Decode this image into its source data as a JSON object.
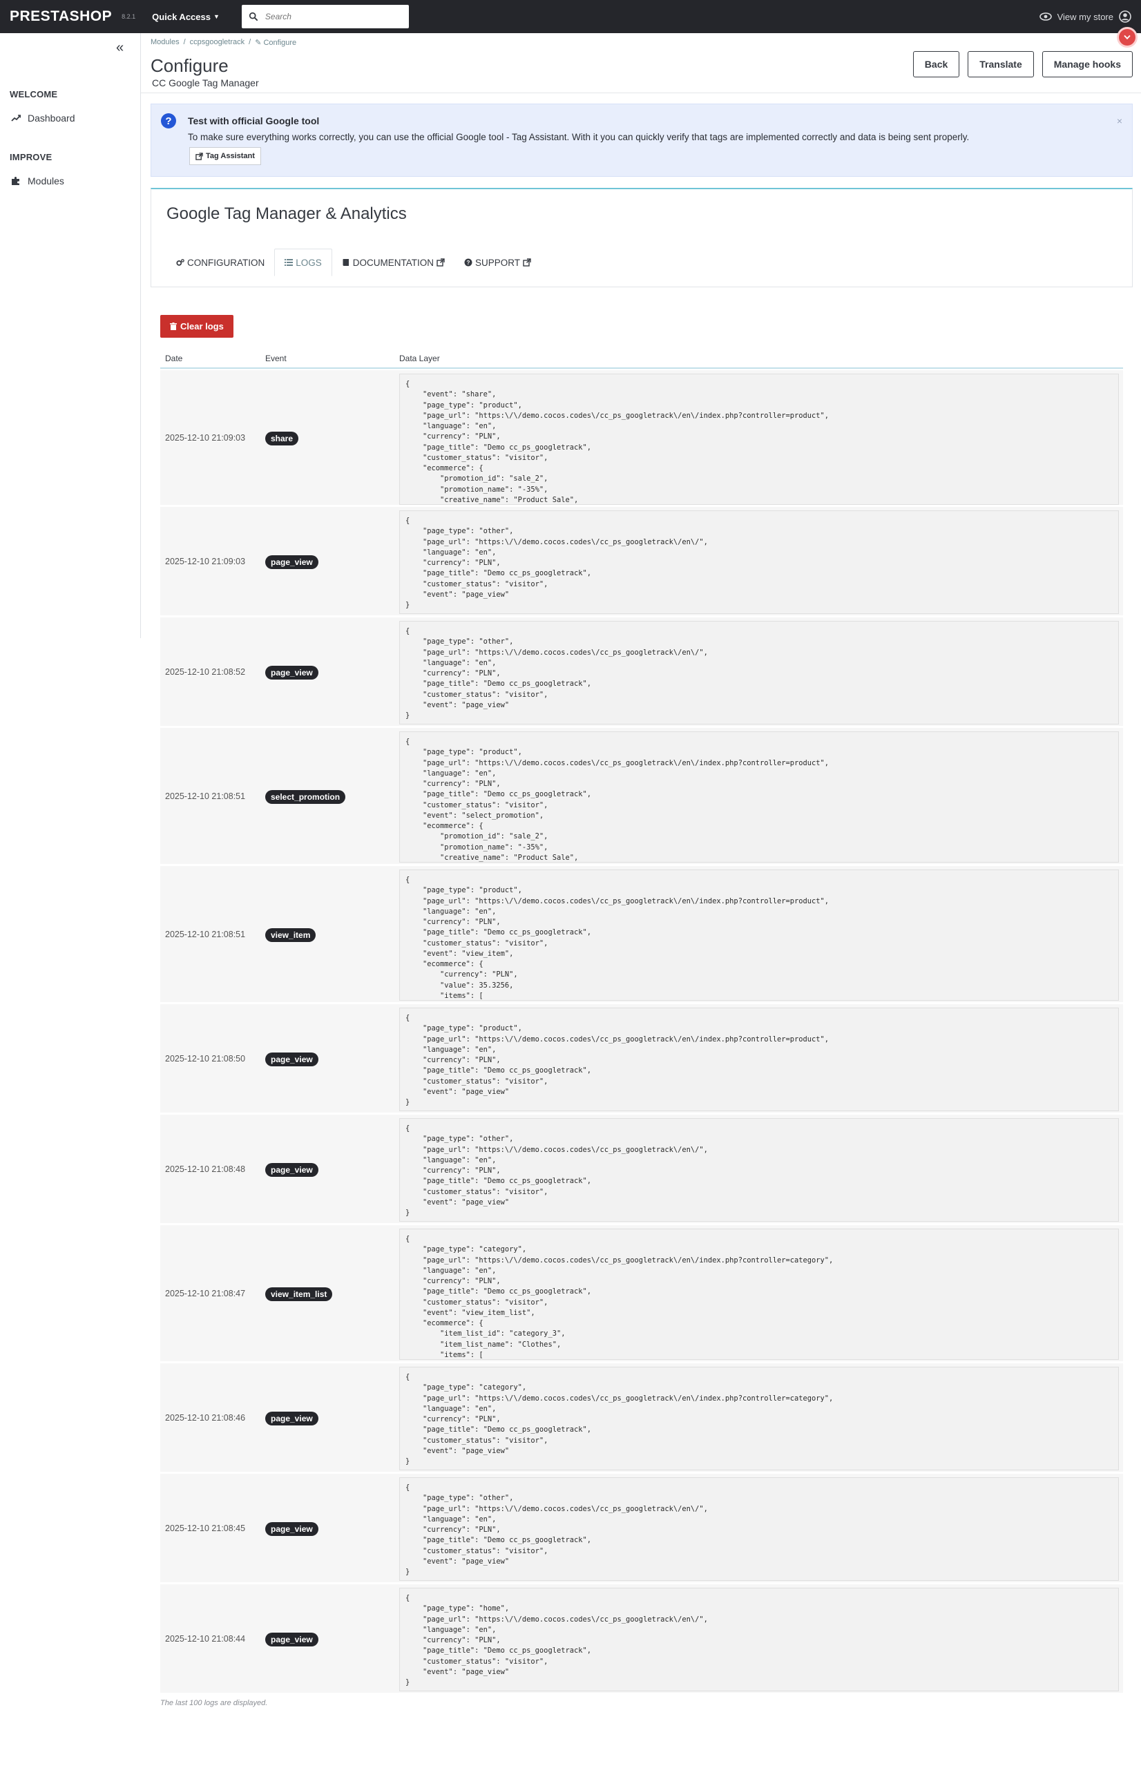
{
  "topbar": {
    "logo": "PRESTASHOP",
    "version": "8.2.1",
    "quick_access": "Quick Access",
    "search_placeholder": "Search",
    "view_store": "View my store"
  },
  "sidebar": {
    "sections": [
      {
        "title": "WELCOME",
        "items": [
          {
            "label": "Dashboard",
            "icon": "trending-up-icon"
          }
        ]
      },
      {
        "title": "IMPROVE",
        "items": [
          {
            "label": "Modules",
            "icon": "puzzle-icon"
          }
        ]
      }
    ]
  },
  "header": {
    "breadcrumb": [
      "Modules",
      "ccpsgoogletrack",
      "Configure"
    ],
    "title": "Configure",
    "subtitle": "CC Google Tag Manager",
    "buttons": {
      "back": "Back",
      "translate": "Translate",
      "manage_hooks": "Manage hooks"
    }
  },
  "alert": {
    "title": "Test with official Google tool",
    "text": "To make sure everything works correctly, you can use the official Google tool - Tag Assistant. With it you can quickly verify that tags are implemented correctly and data is being sent properly.",
    "button": "Tag Assistant",
    "close": "×"
  },
  "module": {
    "title": "Google Tag Manager & Analytics",
    "tabs": [
      {
        "label": "CONFIGURATION",
        "icon": "cogs-icon",
        "active": false
      },
      {
        "label": "LOGS",
        "icon": "list-icon",
        "active": true
      },
      {
        "label": "DOCUMENTATION",
        "icon": "book-icon",
        "active": false
      },
      {
        "label": "SUPPORT",
        "icon": "question-circle-icon",
        "active": false
      }
    ]
  },
  "logs": {
    "clear_button": "Clear logs",
    "columns": {
      "date": "Date",
      "event": "Event",
      "data_layer": "Data Layer"
    },
    "rows": [
      {
        "date": "2025-12-10 21:09:03",
        "event": "share",
        "data": "{\n    \"event\": \"share\",\n    \"page_type\": \"product\",\n    \"page_url\": \"https:\\/\\/demo.cocos.codes\\/cc_ps_googletrack\\/en\\/index.php?controller=product\",\n    \"language\": \"en\",\n    \"currency\": \"PLN\",\n    \"page_title\": \"Demo cc_ps_googletrack\",\n    \"customer_status\": \"visitor\",\n    \"ecommerce\": {\n        \"promotion_id\": \"sale_2\",\n        \"promotion_name\": \"-35%\",\n        \"creative_name\": \"Product Sale\","
      },
      {
        "date": "2025-12-10 21:09:03",
        "event": "page_view",
        "data": "{\n    \"page_type\": \"other\",\n    \"page_url\": \"https:\\/\\/demo.cocos.codes\\/cc_ps_googletrack\\/en\\/\",\n    \"language\": \"en\",\n    \"currency\": \"PLN\",\n    \"page_title\": \"Demo cc_ps_googletrack\",\n    \"customer_status\": \"visitor\",\n    \"event\": \"page_view\"\n}"
      },
      {
        "date": "2025-12-10 21:08:52",
        "event": "page_view",
        "data": "{\n    \"page_type\": \"other\",\n    \"page_url\": \"https:\\/\\/demo.cocos.codes\\/cc_ps_googletrack\\/en\\/\",\n    \"language\": \"en\",\n    \"currency\": \"PLN\",\n    \"page_title\": \"Demo cc_ps_googletrack\",\n    \"customer_status\": \"visitor\",\n    \"event\": \"page_view\"\n}"
      },
      {
        "date": "2025-12-10 21:08:51",
        "event": "select_promotion",
        "data": "{\n    \"page_type\": \"product\",\n    \"page_url\": \"https:\\/\\/demo.cocos.codes\\/cc_ps_googletrack\\/en\\/index.php?controller=product\",\n    \"language\": \"en\",\n    \"currency\": \"PLN\",\n    \"page_title\": \"Demo cc_ps_googletrack\",\n    \"customer_status\": \"visitor\",\n    \"event\": \"select_promotion\",\n    \"ecommerce\": {\n        \"promotion_id\": \"sale_2\",\n        \"promotion_name\": \"-35%\",\n        \"creative_name\": \"Product Sale\","
      },
      {
        "date": "2025-12-10 21:08:51",
        "event": "view_item",
        "data": "{\n    \"page_type\": \"product\",\n    \"page_url\": \"https:\\/\\/demo.cocos.codes\\/cc_ps_googletrack\\/en\\/index.php?controller=product\",\n    \"language\": \"en\",\n    \"currency\": \"PLN\",\n    \"page_title\": \"Demo cc_ps_googletrack\",\n    \"customer_status\": \"visitor\",\n    \"event\": \"view_item\",\n    \"ecommerce\": {\n        \"currency\": \"PLN\",\n        \"value\": 35.3256,\n        \"items\": ["
      },
      {
        "date": "2025-12-10 21:08:50",
        "event": "page_view",
        "data": "{\n    \"page_type\": \"product\",\n    \"page_url\": \"https:\\/\\/demo.cocos.codes\\/cc_ps_googletrack\\/en\\/index.php?controller=product\",\n    \"language\": \"en\",\n    \"currency\": \"PLN\",\n    \"page_title\": \"Demo cc_ps_googletrack\",\n    \"customer_status\": \"visitor\",\n    \"event\": \"page_view\"\n}"
      },
      {
        "date": "2025-12-10 21:08:48",
        "event": "page_view",
        "data": "{\n    \"page_type\": \"other\",\n    \"page_url\": \"https:\\/\\/demo.cocos.codes\\/cc_ps_googletrack\\/en\\/\",\n    \"language\": \"en\",\n    \"currency\": \"PLN\",\n    \"page_title\": \"Demo cc_ps_googletrack\",\n    \"customer_status\": \"visitor\",\n    \"event\": \"page_view\"\n}"
      },
      {
        "date": "2025-12-10 21:08:47",
        "event": "view_item_list",
        "data": "{\n    \"page_type\": \"category\",\n    \"page_url\": \"https:\\/\\/demo.cocos.codes\\/cc_ps_googletrack\\/en\\/index.php?controller=category\",\n    \"language\": \"en\",\n    \"currency\": \"PLN\",\n    \"page_title\": \"Demo cc_ps_googletrack\",\n    \"customer_status\": \"visitor\",\n    \"event\": \"view_item_list\",\n    \"ecommerce\": {\n        \"item_list_id\": \"category_3\",\n        \"item_list_name\": \"Clothes\",\n        \"items\": ["
      },
      {
        "date": "2025-12-10 21:08:46",
        "event": "page_view",
        "data": "{\n    \"page_type\": \"category\",\n    \"page_url\": \"https:\\/\\/demo.cocos.codes\\/cc_ps_googletrack\\/en\\/index.php?controller=category\",\n    \"language\": \"en\",\n    \"currency\": \"PLN\",\n    \"page_title\": \"Demo cc_ps_googletrack\",\n    \"customer_status\": \"visitor\",\n    \"event\": \"page_view\"\n}"
      },
      {
        "date": "2025-12-10 21:08:45",
        "event": "page_view",
        "data": "{\n    \"page_type\": \"other\",\n    \"page_url\": \"https:\\/\\/demo.cocos.codes\\/cc_ps_googletrack\\/en\\/\",\n    \"language\": \"en\",\n    \"currency\": \"PLN\",\n    \"page_title\": \"Demo cc_ps_googletrack\",\n    \"customer_status\": \"visitor\",\n    \"event\": \"page_view\"\n}"
      },
      {
        "date": "2025-12-10 21:08:44",
        "event": "page_view",
        "data": "{\n    \"page_type\": \"home\",\n    \"page_url\": \"https:\\/\\/demo.cocos.codes\\/cc_ps_googletrack\\/en\\/\",\n    \"language\": \"en\",\n    \"currency\": \"PLN\",\n    \"page_title\": \"Demo cc_ps_googletrack\",\n    \"customer_status\": \"visitor\",\n    \"event\": \"page_view\"\n}"
      }
    ],
    "footnote": "The last 100 logs are displayed."
  },
  "colors": {
    "topbar": "#25262b",
    "danger": "#c9302c",
    "info_bg": "#e8eefc",
    "accent": "#6fc4d6"
  }
}
